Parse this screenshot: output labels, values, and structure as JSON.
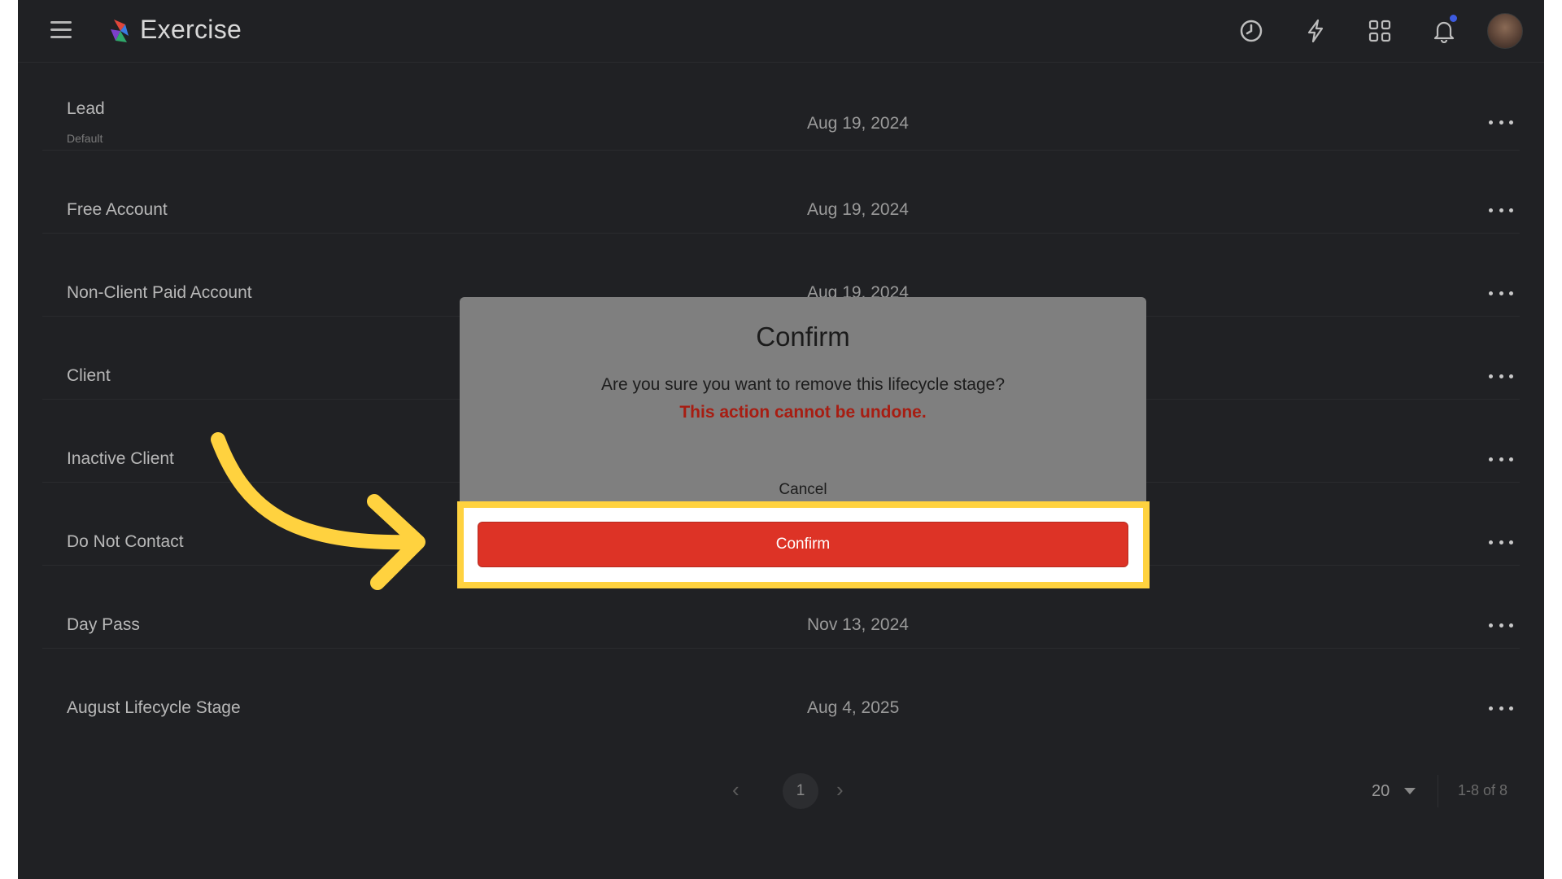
{
  "header": {
    "app_title": "Exercise",
    "icons": [
      "history-icon",
      "bolt-icon",
      "apps-grid-icon",
      "bell-icon"
    ]
  },
  "rows": [
    {
      "name": "Lead",
      "sub": "Default",
      "date": "Aug 19, 2024"
    },
    {
      "name": "Free Account",
      "date": "Aug 19, 2024"
    },
    {
      "name": "Non-Client Paid Account",
      "date": "Aug 19, 2024"
    },
    {
      "name": "Client",
      "date": ""
    },
    {
      "name": "Inactive Client",
      "date": ""
    },
    {
      "name": "Do Not Contact",
      "date": ""
    },
    {
      "name": "Day Pass",
      "date": "Nov 13, 2024"
    },
    {
      "name": "August Lifecycle Stage",
      "date": "Aug 4, 2025"
    }
  ],
  "pagination": {
    "prev": "‹",
    "page": "1",
    "next": "›",
    "per_page": "20",
    "range": "1-8 of 8"
  },
  "dialog": {
    "title": "Confirm",
    "message": "Are you sure you want to remove this lifecycle stage?",
    "warning": "This action cannot be undone.",
    "cancel_label": "Cancel",
    "confirm_label": "Confirm"
  },
  "colors": {
    "background": "#202124",
    "dialog": "#7f7f7f",
    "confirm": "#dd3326",
    "warning_text": "#a71d12",
    "highlight": "#ffd23f"
  }
}
